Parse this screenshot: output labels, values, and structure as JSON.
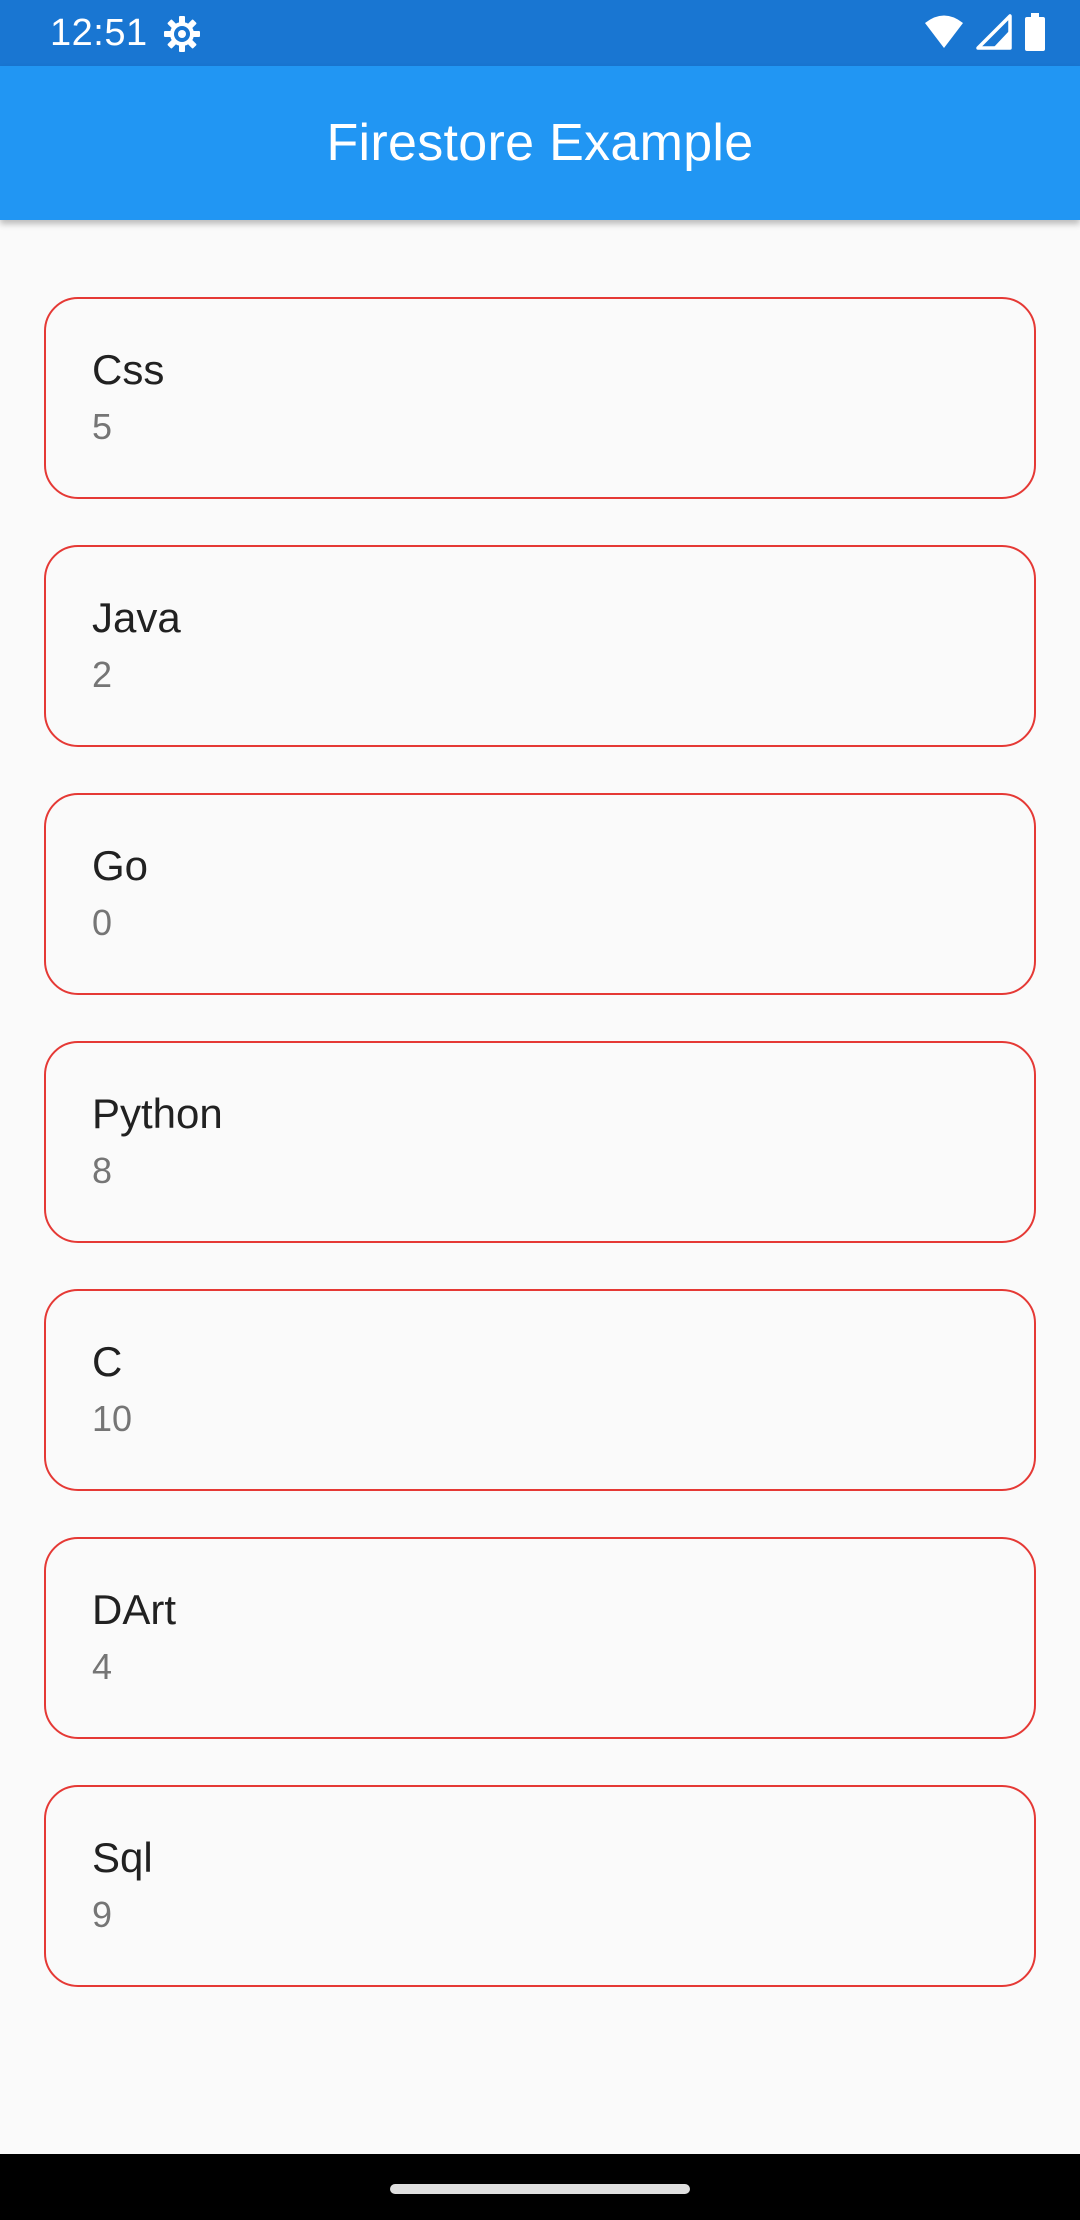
{
  "status_bar": {
    "time": "12:51"
  },
  "app_bar": {
    "title": "Firestore Example"
  },
  "items": [
    {
      "name": "Css",
      "count": "5"
    },
    {
      "name": "Java",
      "count": "2"
    },
    {
      "name": "Go",
      "count": "0"
    },
    {
      "name": "Python",
      "count": "8"
    },
    {
      "name": "C",
      "count": "10"
    },
    {
      "name": "DArt",
      "count": "4"
    },
    {
      "name": "Sql",
      "count": "9"
    }
  ],
  "colors": {
    "status_bar": "#1976d2",
    "app_bar": "#2196f3",
    "card_border": "#e53935",
    "background": "#fafafa"
  },
  "icons": {
    "status_left": "settings-gear-icon",
    "status_right": [
      "wifi-icon",
      "cellular-signal-icon",
      "battery-icon"
    ]
  }
}
